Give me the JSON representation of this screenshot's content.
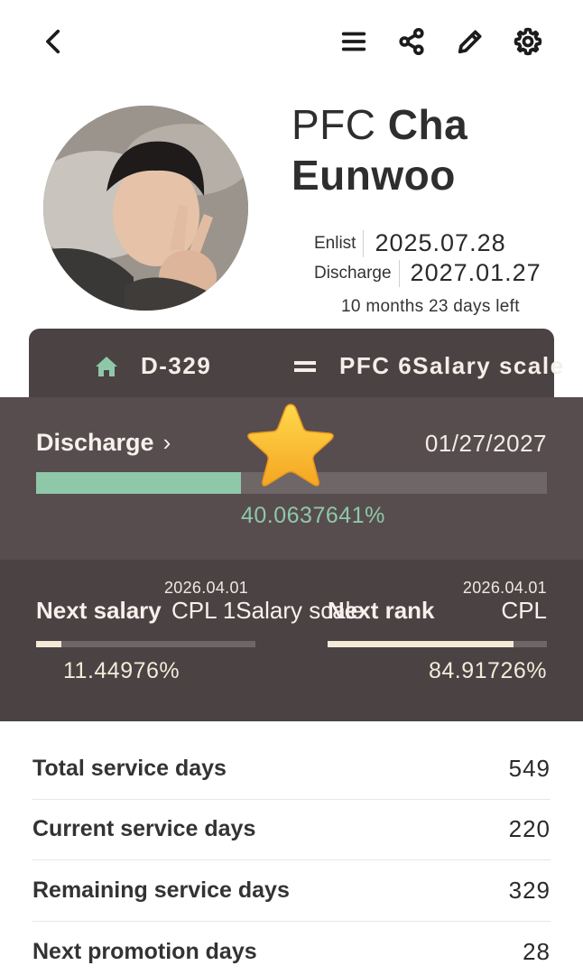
{
  "header": {
    "icons": [
      "chevron-left-icon",
      "menu-icon",
      "share-icon",
      "pencil-icon",
      "gear-icon"
    ]
  },
  "profile": {
    "rank": "PFC",
    "surname": "Cha",
    "given_name": "Eunwoo",
    "enlist_label": "Enlist",
    "enlist_date": "2025.07.28",
    "discharge_label": "Discharge",
    "discharge_date": "2027.01.27",
    "time_left": "10 months 23 days left"
  },
  "tabs": {
    "dday": "D-329",
    "salary": "PFC 6Salary scale"
  },
  "discharge": {
    "title": "Discharge",
    "date": "01/27/2027",
    "percent_text": "40.0637641%",
    "percent": 40.0637641
  },
  "next_salary": {
    "date": "2026.04.01",
    "title": "Next salary",
    "value": "CPL 1Salary scale",
    "percent_text": "11.44976%",
    "percent": 11.44976
  },
  "next_rank": {
    "date": "2026.04.01",
    "title": "Next rank",
    "value": "CPL",
    "percent_text": "84.91726%",
    "percent": 84.91726
  },
  "stats": [
    {
      "label": "Total service days",
      "value": "549"
    },
    {
      "label": "Current service days",
      "value": "220"
    },
    {
      "label": "Remaining service days",
      "value": "329"
    },
    {
      "label": "Next promotion days",
      "value": "28"
    }
  ],
  "colors": {
    "accent_green": "#8fc7a9",
    "dark_card": "#4a4243",
    "panel": "#574d4e",
    "cream": "#f3ead8"
  }
}
